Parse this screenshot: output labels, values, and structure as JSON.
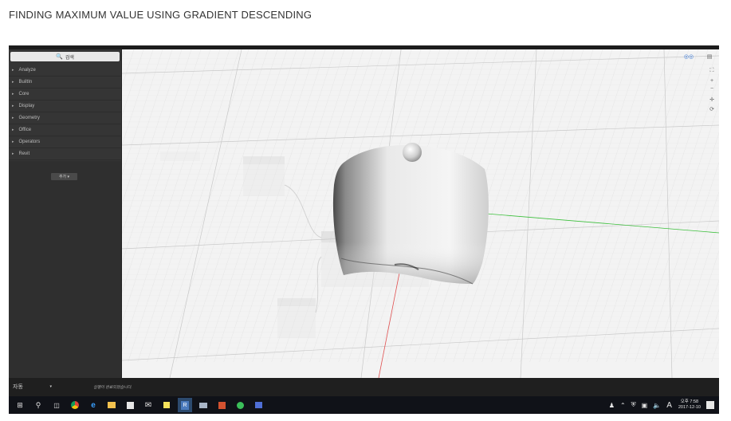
{
  "slide": {
    "title": "FINDING MAXIMUM VALUE USING GRADIENT DESCENDING"
  },
  "library": {
    "search_placeholder": "검색",
    "items": [
      "Analyze",
      "BuiltIn",
      "Core",
      "Display",
      "Geometry",
      "Office",
      "Operators",
      "Revit"
    ],
    "add_label": "추가"
  },
  "viewport": {
    "grid_color": "#d6d6d6",
    "x_axis_color": "#e05050",
    "y_axis_color": "#3bbf3b",
    "surface_color": "#e8e8e8"
  },
  "statusbar": {
    "run_mode": "자동",
    "message": "실행이 완료되었습니다."
  },
  "taskbar": {
    "icons": [
      "windows-start-icon",
      "search-icon",
      "task-view-icon",
      "chrome-icon",
      "edge-icon",
      "file-explorer-icon",
      "store-icon",
      "mail-icon",
      "sticky-notes-icon",
      "revit-icon",
      "display-icon",
      "powerpoint-icon",
      "spotify-icon",
      "app-icon"
    ],
    "tray_lang": "A",
    "clock_period": "오후 7:58",
    "clock_date": "2017-12-10"
  }
}
